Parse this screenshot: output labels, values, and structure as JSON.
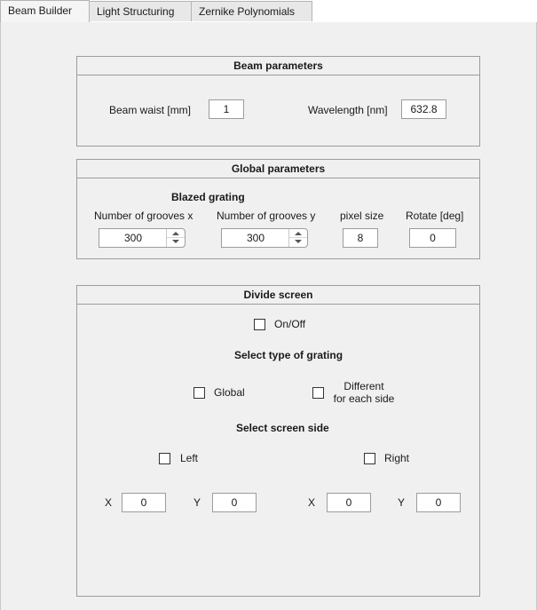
{
  "tabs": [
    {
      "label": "Beam Builder",
      "active": true
    },
    {
      "label": "Light Structuring",
      "active": false
    },
    {
      "label": "Zernike Polynomials",
      "active": false
    }
  ],
  "beam_parameters": {
    "title": "Beam parameters",
    "beam_waist_label": "Beam waist [mm]",
    "beam_waist_value": "1",
    "wavelength_label": "Wavelength [nm]",
    "wavelength_value": "632.8"
  },
  "global_parameters": {
    "title": "Global parameters",
    "subtitle": "Blazed grating",
    "grooves_x_label": "Number of grooves x",
    "grooves_x_value": "300",
    "grooves_y_label": "Number of grooves y",
    "grooves_y_value": "300",
    "pixel_size_label": "pixel size",
    "pixel_size_value": "8",
    "rotate_label": "Rotate [deg]",
    "rotate_value": "0"
  },
  "divide_screen": {
    "title": "Divide screen",
    "on_off_label": "On/Off",
    "select_grating_label": "Select type of grating",
    "global_label": "Global",
    "different_label_line1": "Different",
    "different_label_line2": "for each side",
    "select_side_label": "Select screen side",
    "left_label": "Left",
    "right_label": "Right",
    "x_label": "X",
    "y_label": "Y",
    "left_x_value": "0",
    "left_y_value": "0",
    "right_x_value": "0",
    "right_y_value": "0"
  }
}
